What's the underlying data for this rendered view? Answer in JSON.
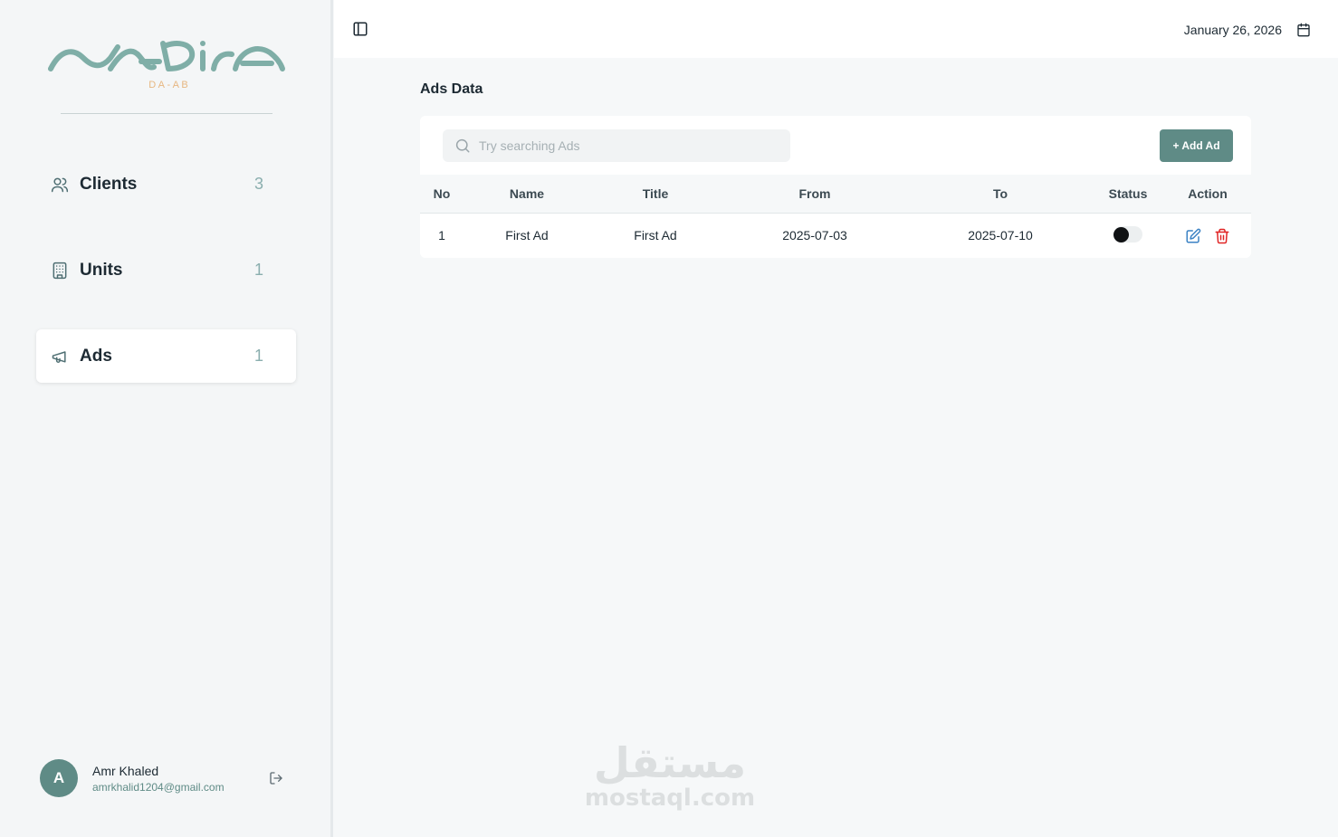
{
  "brand": {
    "logo_text": "NADIRA",
    "logo_sub": "D A - A B",
    "logo_color": "#7faea7",
    "logo_sub_color": "#e7b782"
  },
  "sidebar": {
    "items": [
      {
        "label": "Clients",
        "count": "3",
        "icon": "users-icon",
        "active": false
      },
      {
        "label": "Units",
        "count": "1",
        "icon": "building-icon",
        "active": false
      },
      {
        "label": "Ads",
        "count": "1",
        "icon": "megaphone-icon",
        "active": true
      }
    ]
  },
  "user": {
    "initial": "A",
    "name": "Amr Khaled",
    "email": "amrkhalid1204@gmail.com"
  },
  "topbar": {
    "date": "January 26, 2026"
  },
  "main": {
    "title": "Ads Data",
    "search_placeholder": "Try searching Ads",
    "add_button": "+ Add Ad",
    "columns": [
      "No",
      "Name",
      "Title",
      "From",
      "To",
      "Status",
      "Action"
    ],
    "rows": [
      {
        "no": "1",
        "name": "First Ad",
        "title": "First Ad",
        "from": "2025-07-03",
        "to": "2025-07-10",
        "status": false
      }
    ]
  },
  "watermark": {
    "arabic": "مستقل",
    "latin": "mostaql.com"
  },
  "colors": {
    "accent": "#5f8b86",
    "edit": "#3b82c4",
    "delete": "#e02424"
  }
}
